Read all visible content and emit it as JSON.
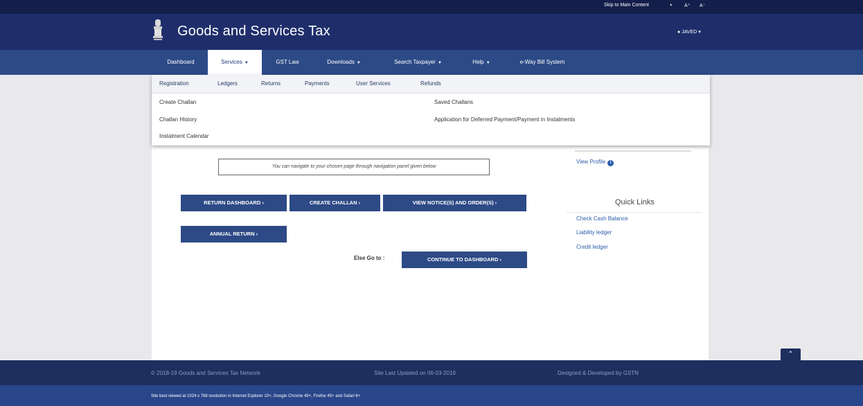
{
  "utility": {
    "skip": "Skip to Main Content",
    "contrast_icon": "contrast-icon",
    "font_up": "A⁺",
    "font_down": "A⁻"
  },
  "header": {
    "title": "Goods and Services Tax",
    "user": "JAVED",
    "emblem_icon": "national-emblem-icon"
  },
  "nav": {
    "items": [
      {
        "label": "Dashboard"
      },
      {
        "label": "Services"
      },
      {
        "label": "GST Law"
      },
      {
        "label": "Downloads"
      },
      {
        "label": "Search Taxpayer"
      },
      {
        "label": "Help"
      },
      {
        "label": "e-Way Bill System"
      }
    ],
    "active": "Services"
  },
  "submenu": {
    "tabs": [
      "Registration",
      "Ledgers",
      "Returns",
      "Payments",
      "User Services",
      "Refunds"
    ],
    "left_links": [
      "Create Challan",
      "Challan History",
      "Instalment Calendar"
    ],
    "right_links": [
      "Saved Challans",
      "Application for Deferred Payment/Payment in Instalments"
    ]
  },
  "main": {
    "hint": "You can navigate to your chosen page through navigation panel given below",
    "buttons": {
      "return_dashboard": "RETURN DASHBOARD ›",
      "create_challan": "CREATE CHALLAN ›",
      "view_notices": "VIEW NOTICE(S) AND ORDER(S) ›",
      "annual_return": "ANNUAL RETURN ›",
      "continue_dashboard": "CONTINUE TO DASHBOARD ›"
    },
    "else_label": "Else Go to :"
  },
  "sidebar": {
    "view_profile": "View Profile",
    "quick_links_title": "Quick Links",
    "quick_links": [
      "Check Cash Balance",
      "Liability ledger",
      "Credit ledger"
    ]
  },
  "footer": {
    "copyright": "© 2018-19 Goods and Services Tax Network",
    "updated": "Site Last Updated on 06-03-2019",
    "designed": "Designed & Developed by GSTN",
    "best_viewed": "Site best viewed at 1024 x 768 resolution in Internet Explorer 10+, Google Chrome 49+, Firefox 45+ and Safari 6+"
  },
  "colors": {
    "header": "#1f2e6b",
    "nav": "#2c4a86",
    "button": "#2d4a86",
    "link": "#2a5caa",
    "footer": "#1d2f5e"
  }
}
